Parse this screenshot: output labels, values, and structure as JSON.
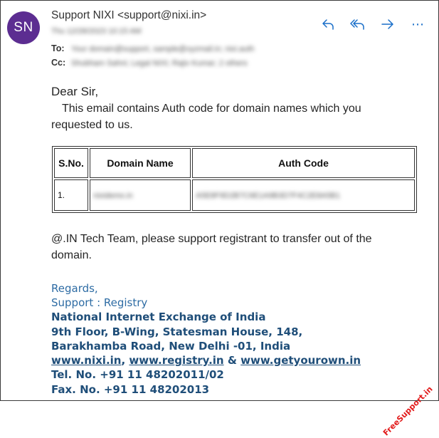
{
  "sender": {
    "avatar_initials": "SN",
    "display": "Support NIXI <support@nixi.in>",
    "date_blurred": "Thu 12/28/2023 10:15 AM"
  },
  "recipients": {
    "to_label": "To:",
    "to_blurred": "Your domain@support, sample@xyzmail.in; nixi.auth",
    "cc_label": "Cc:",
    "cc_blurred": "Shubham Sahni; Legal NIXI; Rajiv Kumar; 2 others"
  },
  "actions": {
    "reply_icon": "reply-icon",
    "reply_all_icon": "reply-all-icon",
    "forward_icon": "forward-icon",
    "more_icon": "more-icon",
    "more_label": "⋯",
    "accent_color": "#1a6fc9"
  },
  "message": {
    "greeting": "Dear Sir,",
    "intro_line1": "This email contains Auth code for domain names which you",
    "intro_line2": "requested to us.",
    "table": {
      "headers": [
        "S.No.",
        "Domain Name",
        "Auth Code"
      ],
      "rows": [
        {
          "sno": "1.",
          "domain_blurred": "nixidemo.in",
          "auth_blurred": "A5E8F9D2B7C6E1A9B3D7F4C2E8A5B1"
        }
      ]
    },
    "outro_line1": "@.IN Tech Team, please support registrant to transfer out of the",
    "outro_line2": "domain."
  },
  "signature": {
    "regards": "Regards,",
    "dept": "Support : Registry",
    "org": "National Internet Exchange of India",
    "address1": "9th Floor, B-Wing, Statesman House, 148,",
    "address2": "Barakhamba Road, New Delhi -01, India",
    "link1": "www.nixi.in",
    "sep1": ",",
    "link2": "www.registry.in",
    "sep2": "&",
    "link3": "www.getyourown.in",
    "tel": "Tel. No. +91 11 48202011/02",
    "fax": "Fax. No. +91 11 48202013",
    "color": "#1f4e79"
  },
  "watermark": {
    "text": "FreeSupport.in",
    "color": "#e21b1b"
  }
}
